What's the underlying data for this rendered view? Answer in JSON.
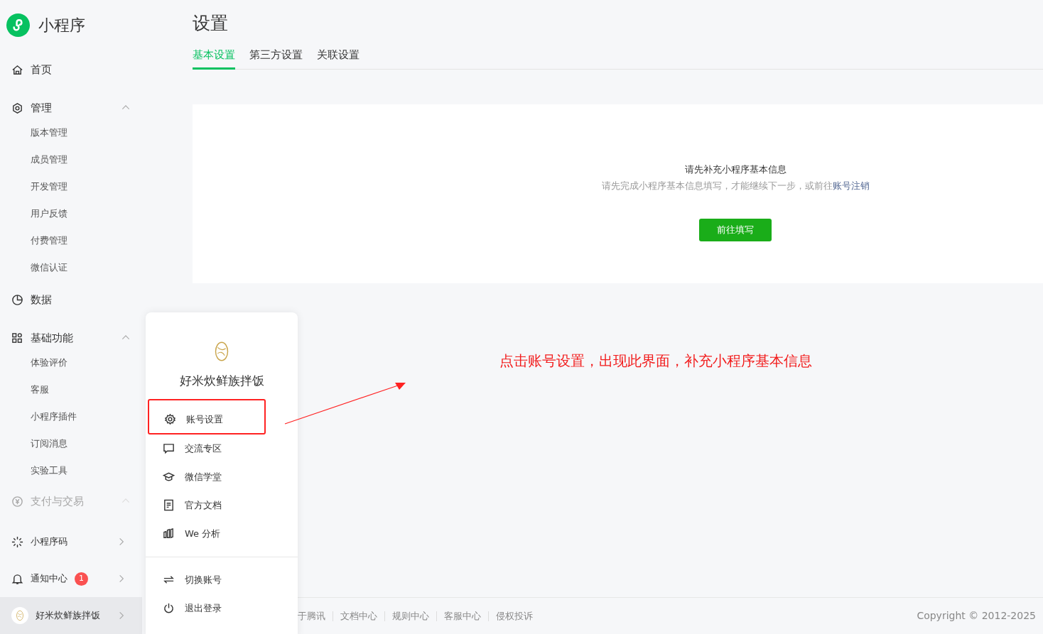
{
  "brand": {
    "title": "小程序"
  },
  "sidebar": {
    "items": [
      {
        "kind": "link",
        "label": "首页",
        "disabled": false
      },
      {
        "kind": "group",
        "label": "管理",
        "expanded": true,
        "disabled": false,
        "children": [
          {
            "label": "版本管理"
          },
          {
            "label": "成员管理"
          },
          {
            "label": "开发管理"
          },
          {
            "label": "用户反馈"
          },
          {
            "label": "付费管理"
          },
          {
            "label": "微信认证"
          }
        ]
      },
      {
        "kind": "link",
        "label": "数据",
        "disabled": false
      },
      {
        "kind": "group",
        "label": "基础功能",
        "expanded": true,
        "disabled": false,
        "children": [
          {
            "label": "体验评价"
          },
          {
            "label": "客服"
          },
          {
            "label": "小程序插件"
          },
          {
            "label": "订阅消息"
          },
          {
            "label": "实验工具"
          }
        ]
      },
      {
        "kind": "group",
        "label": "支付与交易",
        "expanded": true,
        "disabled": true
      }
    ],
    "bottom": [
      {
        "kind": "link",
        "label": "小程序码",
        "selected": false
      },
      {
        "kind": "link",
        "label": "通知中心",
        "badge": "1",
        "selected": false
      },
      {
        "kind": "account",
        "label": "好米炊鲜族拌饭",
        "selected": true
      }
    ]
  },
  "page": {
    "title": "设置",
    "tabs": [
      {
        "label": "基本设置",
        "selected": true
      },
      {
        "label": "第三方设置",
        "selected": false
      },
      {
        "label": "关联设置",
        "selected": false
      }
    ],
    "notice": {
      "title": "请先补充小程序基本信息",
      "text": "请先完成小程序基本信息填写，才能继续下一步，或前往",
      "link": "账号注销",
      "button": "前往填写"
    }
  },
  "account_menu": {
    "name": "好米炊鲜族拌饭",
    "items": [
      {
        "label": "账号设置",
        "highlighted": true
      },
      {
        "label": "交流专区",
        "highlighted": false
      },
      {
        "label": "微信学堂",
        "highlighted": false
      },
      {
        "label": "官方文档",
        "highlighted": false
      },
      {
        "label": "We 分析",
        "highlighted": false
      }
    ],
    "actions": [
      {
        "label": "切换账号"
      },
      {
        "label": "退出登录"
      }
    ]
  },
  "annotation": {
    "text": "点击账号设置，出现此界面，补充小程序基本信息"
  },
  "footer": {
    "links": [
      "于腾讯",
      "文档中心",
      "规则中心",
      "客服中心",
      "侵权投诉"
    ],
    "copyright": "Copyright © 2012-2025"
  }
}
